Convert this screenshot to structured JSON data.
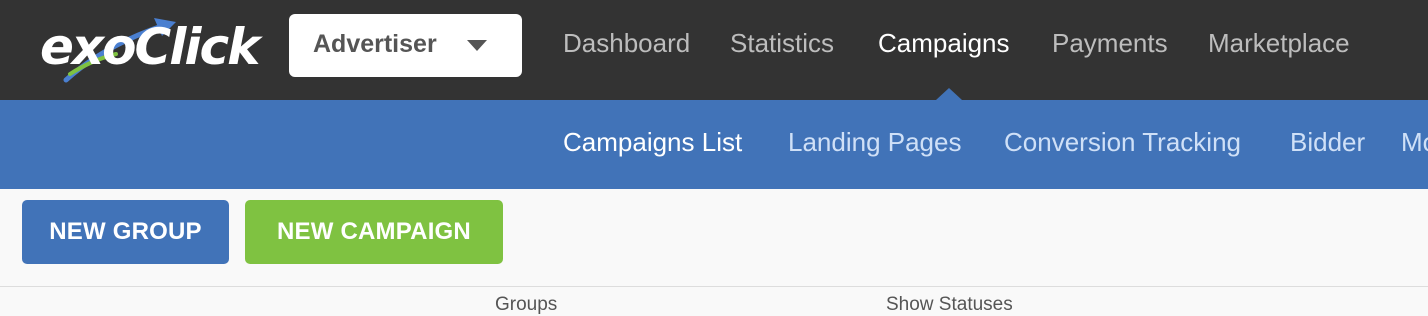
{
  "brand": {
    "logo_text": "exoClick",
    "colors": {
      "topbar": "#333333",
      "accent_blue": "#4173b8",
      "accent_green": "#7fc241"
    }
  },
  "role_select": {
    "value": "Advertiser",
    "icon": "caret-down-icon"
  },
  "main_nav": {
    "items": [
      {
        "label": "Dashboard"
      },
      {
        "label": "Statistics"
      },
      {
        "label": "Campaigns",
        "active": true
      },
      {
        "label": "Payments"
      },
      {
        "label": "Marketplace"
      }
    ]
  },
  "sub_nav": {
    "items": [
      {
        "label": "Campaigns List",
        "active": true
      },
      {
        "label": "Landing Pages"
      },
      {
        "label": "Conversion Tracking"
      },
      {
        "label": "Bidder"
      },
      {
        "label": "Mo"
      }
    ]
  },
  "toolbar": {
    "new_group_label": "NEW GROUP",
    "new_campaign_label": "NEW CAMPAIGN"
  },
  "filters": {
    "groups_label": "Groups",
    "statuses_label": "Show Statuses"
  }
}
